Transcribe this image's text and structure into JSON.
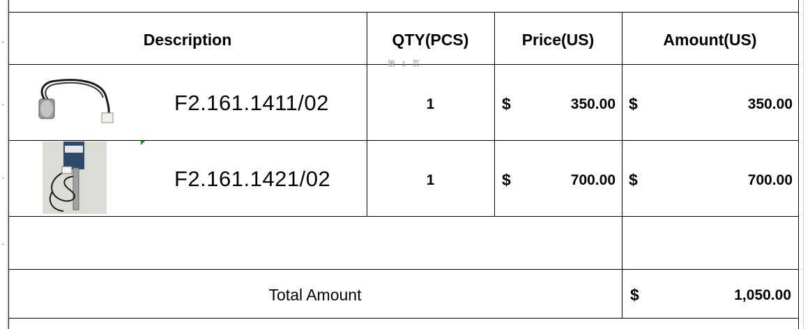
{
  "table": {
    "headers": {
      "description": "Description",
      "qty": "QTY(PCS)",
      "price": "Price(US)",
      "amount": "Amount(US)"
    },
    "page_marker": "第 1 页",
    "rows": [
      {
        "product_code": "F2.161.1411/02",
        "qty": "1",
        "price_currency": "$",
        "price": "350.00",
        "amount_currency": "$",
        "amount": "350.00"
      },
      {
        "product_code": "F2.161.1421/02",
        "qty": "1",
        "price_currency": "$",
        "price": "700.00",
        "amount_currency": "$",
        "amount": "700.00"
      }
    ],
    "total": {
      "label": "Total Amount",
      "currency": "$",
      "value": "1,050.00"
    }
  }
}
